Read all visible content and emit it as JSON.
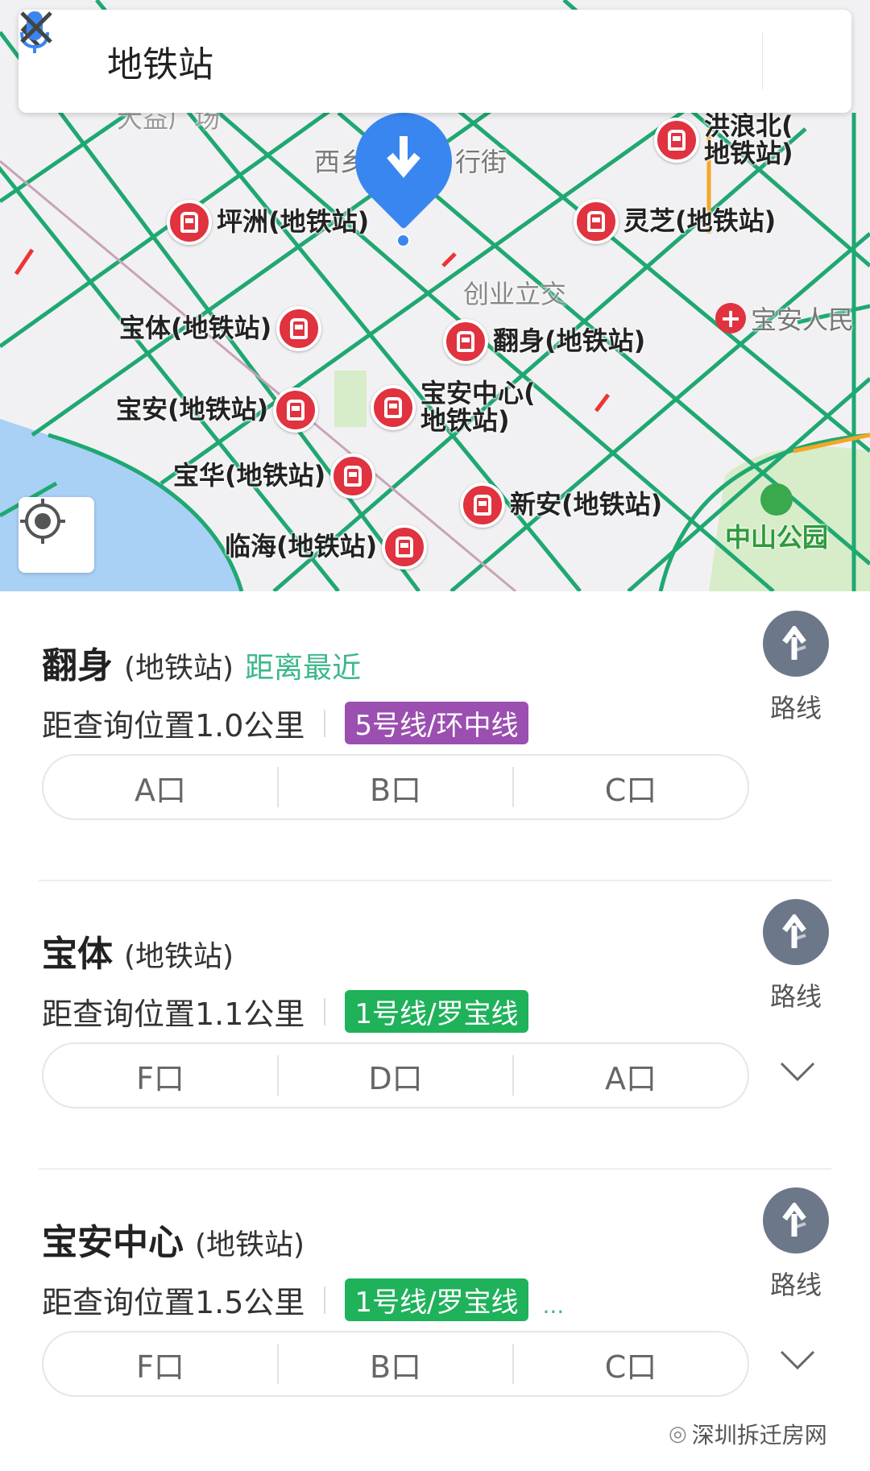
{
  "search": {
    "query": "地铁站",
    "back_icon": "chevron-left-icon",
    "mic_icon": "microphone-icon",
    "clear_icon": "close-icon"
  },
  "map": {
    "stations": [
      {
        "name": "坪洲(地铁站)"
      },
      {
        "name": "灵芝(地铁站)"
      },
      {
        "name": "洪浪北(",
        "name2": "地铁站)"
      },
      {
        "name": "宝体(地铁站)"
      },
      {
        "name": "翻身(地铁站)"
      },
      {
        "name": "宝安(地铁站)"
      },
      {
        "name": "宝安中心(",
        "name2": "地铁站)"
      },
      {
        "name": "宝华(地铁站)"
      },
      {
        "name": "新安(地铁站)"
      },
      {
        "name": "临海(地铁站)"
      }
    ],
    "labels": {
      "interchange": "创业立交",
      "hospital": "宝安人民",
      "park": "中山公园",
      "street_a": "西乡",
      "street_b": "行街",
      "plaza": "大益广场"
    },
    "colors": {
      "road": "#1fa871",
      "station": "#e0323f",
      "pin": "#3a86f0",
      "water": "#a9d0f5",
      "park": "#d7ecc9"
    }
  },
  "results": [
    {
      "name": "翻身",
      "suffix": "(地铁站)",
      "tag": "距离最近",
      "distance": "距查询位置1.0公里",
      "line": "5号线/环中线",
      "line_color": "#9b4fb0",
      "exits": [
        "A口",
        "B口",
        "C口"
      ],
      "route": "路线",
      "expand": false
    },
    {
      "name": "宝体",
      "suffix": "(地铁站)",
      "tag": "",
      "distance": "距查询位置1.1公里",
      "line": "1号线/罗宝线",
      "line_color": "#1fb25a",
      "exits": [
        "F口",
        "D口",
        "A口"
      ],
      "route": "路线",
      "expand": true
    },
    {
      "name": "宝安中心",
      "suffix": "(地铁站)",
      "tag": "",
      "distance": "距查询位置1.5公里",
      "line": "1号线/罗宝线",
      "line_color": "#1fb25a",
      "more": "...",
      "exits": [
        "F口",
        "B口",
        "C口"
      ],
      "route": "路线",
      "expand": true
    }
  ],
  "watermark": "深圳拆迁房网"
}
